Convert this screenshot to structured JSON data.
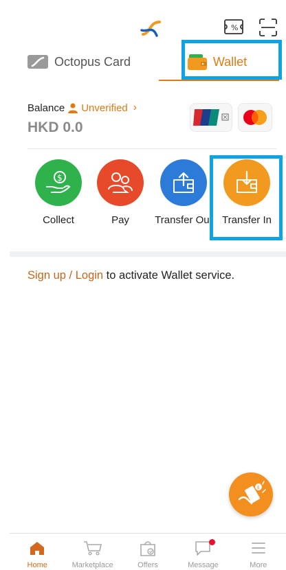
{
  "tabs": [
    {
      "label": "Octopus Card",
      "icon": "octopus-card-icon"
    },
    {
      "label": "Wallet",
      "icon": "wallet-icon",
      "active": true
    }
  ],
  "balance": {
    "label": "Balance",
    "status": "Unverified",
    "amount": "HKD 0.0"
  },
  "payment_logos": [
    "unionpay-logo",
    "mastercard-logo"
  ],
  "actions": [
    {
      "label": "Collect",
      "color": "#2fb24c",
      "icon": "collect-icon"
    },
    {
      "label": "Pay",
      "color": "#e64a2a",
      "icon": "pay-icon"
    },
    {
      "label": "Transfer Out",
      "color": "#2d7bd8",
      "icon": "transfer-out-icon"
    },
    {
      "label": "Transfer In",
      "color": "#f29a1f",
      "icon": "transfer-in-icon"
    }
  ],
  "signup": {
    "link": "Sign up / Login",
    "text": " to activate Wallet service."
  },
  "nav": [
    {
      "label": "Home",
      "icon": "home-icon",
      "active": true
    },
    {
      "label": "Marketplace",
      "icon": "cart-icon"
    },
    {
      "label": "Offers",
      "icon": "offers-icon"
    },
    {
      "label": "Message",
      "icon": "message-icon",
      "badge": true
    },
    {
      "label": "More",
      "icon": "menu-icon"
    }
  ],
  "colors": {
    "accent": "#e07b13",
    "highlight": "#0fa3e6",
    "badge": "#e8112d"
  }
}
